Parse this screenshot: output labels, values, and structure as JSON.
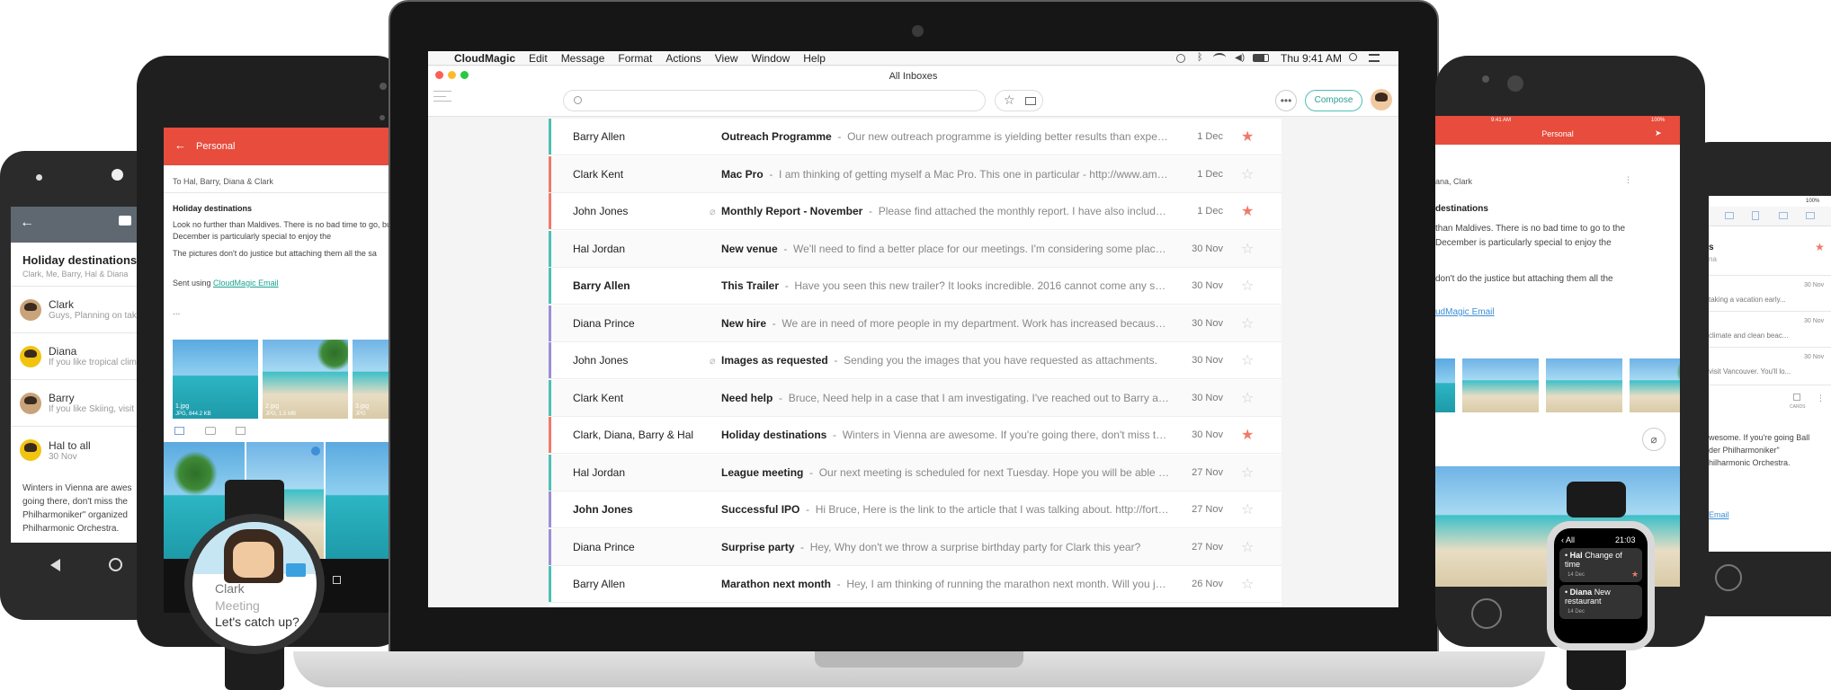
{
  "android_phone": {
    "title": "Holiday destinations",
    "participants": "Clark, Me, Barry, Hal & Diana",
    "items": [
      {
        "name": "Clark",
        "preview": "Guys, Planning on taking"
      },
      {
        "name": "Diana",
        "preview": "If you like tropical climate"
      },
      {
        "name": "Barry",
        "preview": "If you like Skiing, visit Van"
      },
      {
        "name": "Hal to all",
        "preview": "30 Nov"
      }
    ],
    "body": "Winters in Vienna are awes going there, don't miss the Philharmoniker\" organized Philharmonic Orchestra."
  },
  "android_tablet": {
    "folder": "Personal",
    "to": "To Hal, Barry, Diana & Clark",
    "subject": "Holiday destinations",
    "body1": "Look no further than Maldives. There is no bad time to go, but December is particularly special to enjoy the",
    "body2": "The pictures don't do justice but attaching them all the sa",
    "sent_using": "Sent using",
    "sent_link": "CloudMagic Email",
    "ellipsis": "...",
    "attachments": [
      {
        "name": "1.jpg",
        "meta": "JPG, 844.2 KB"
      },
      {
        "name": "2.jpg",
        "meta": "JPG, 1.5 MB"
      },
      {
        "name": "3.jpg",
        "meta": "JPG"
      }
    ]
  },
  "watch_round": {
    "sender": "Clark",
    "subject": "Meeting",
    "preview": "Let's catch up?"
  },
  "mac": {
    "menu": [
      "CloudMagic",
      "Edit",
      "Message",
      "Format",
      "Actions",
      "View",
      "Window",
      "Help"
    ],
    "clock": "Thu 9:41 AM",
    "window_title": "All Inboxes",
    "compose_label": "Compose",
    "emails": [
      {
        "sender": "Barry Allen",
        "subject": "Outreach Programme",
        "preview": "Our new outreach programme is yielding better results than expected. I have s...",
        "date": "1 Dec",
        "starred": true,
        "unread": false,
        "attach": false,
        "color": "#4dc0b5"
      },
      {
        "sender": "Clark Kent",
        "subject": "Mac Pro",
        "preview": "I am thinking of getting myself a Mac Pro. This one in particular - http://www.amazon.com/Ap...",
        "date": "1 Dec",
        "starred": false,
        "unread": false,
        "attach": false,
        "color": "#f07a6a"
      },
      {
        "sender": "John Jones",
        "subject": "Monthly Report - November",
        "preview": "Please find attached the monthly report. I have also included the stats re...",
        "date": "1 Dec",
        "starred": true,
        "unread": false,
        "attach": true,
        "color": "#f07a6a"
      },
      {
        "sender": "Hal Jordan",
        "subject": "New venue",
        "preview": "We'll need to find a better place for our meetings. I'm considering some places. Let me kn...",
        "date": "30 Nov",
        "starred": false,
        "unread": false,
        "attach": false,
        "color": "#4dc0b5"
      },
      {
        "sender": "Barry Allen",
        "subject": "This Trailer",
        "preview": "Have you seen this new trailer? It looks incredible. 2016 cannot come any soon. https://w...",
        "date": "30 Nov",
        "starred": false,
        "unread": true,
        "attach": false,
        "color": "#4dc0b5"
      },
      {
        "sender": "Diana Prince",
        "subject": "New hire",
        "preview": "We are in need of more people in my department. Work has increased because of the new v...",
        "date": "30 Nov",
        "starred": false,
        "unread": false,
        "attach": false,
        "color": "#9b8fd6"
      },
      {
        "sender": "John Jones",
        "subject": "Images as requested",
        "preview": "Sending you the images that you have requested as attachments.",
        "date": "30 Nov",
        "starred": false,
        "unread": false,
        "attach": true,
        "color": "#9b8fd6"
      },
      {
        "sender": "Clark Kent",
        "subject": "Need help",
        "preview": "Bruce, Need help in a case that I am investigating. I've reached out to Barry as well. Let me...",
        "date": "30 Nov",
        "starred": false,
        "unread": false,
        "attach": false,
        "color": "#4dc0b5"
      },
      {
        "sender": "Clark, Diana, Barry & Hal",
        "subject": "Holiday destinations",
        "preview": "Winters in Vienna are awesome. If you're going there, don't miss the \"Ball der Phi...",
        "date": "30 Nov",
        "starred": true,
        "unread": false,
        "attach": false,
        "color": "#f07a6a"
      },
      {
        "sender": "Hal Jordan",
        "subject": "League meeting",
        "preview": "Our next meeting is scheduled for next Tuesday. Hope you will be able to make it.",
        "date": "27 Nov",
        "starred": false,
        "unread": false,
        "attach": false,
        "color": "#4dc0b5"
      },
      {
        "sender": "John Jones",
        "subject": "Successful IPO",
        "preview": "Hi Bruce, Here is the link to the article that I was talking about. http://fortune.com/20...",
        "date": "27 Nov",
        "starred": false,
        "unread": true,
        "attach": false,
        "color": "#9b8fd6"
      },
      {
        "sender": "Diana Prince",
        "subject": "Surprise party",
        "preview": "Hey, Why don't we throw a surprise birthday party for Clark this year?",
        "date": "27 Nov",
        "starred": false,
        "unread": false,
        "attach": false,
        "color": "#9b8fd6"
      },
      {
        "sender": "Barry Allen",
        "subject": "Marathon next month",
        "preview": "Hey, I am thinking of running the marathon next month. Will you join me?",
        "date": "26 Nov",
        "starred": false,
        "unread": false,
        "attach": false,
        "color": "#4dc0b5"
      }
    ]
  },
  "ipad": {
    "status_time": "9:41 AM",
    "status_battery": "100%",
    "folder": "Personal",
    "to_fragment": "ana, Clark",
    "subject_fragment": "destinations",
    "body1": "than Maldives. There is no bad time to go to the December is particularly special to enjoy the",
    "body2": "don't do the justice but attaching them all the",
    "link_fragment": "udMagic Email"
  },
  "apple_watch": {
    "back": "All",
    "time": "21:03",
    "items": [
      {
        "sender": "Hal",
        "subject": "Change of time",
        "date": "14 Dec",
        "starred": true
      },
      {
        "sender": "Diana",
        "subject": "New restaurant",
        "date": "14 Dec",
        "starred": false
      }
    ]
  },
  "iphone": {
    "battery": "100%",
    "items": [
      {
        "title": "s",
        "sub": "na",
        "date": "",
        "preview": ""
      },
      {
        "date": "30 Nov",
        "preview": "taking a vacation early..."
      },
      {
        "date": "30 Nov",
        "preview": "climate and clean beac..."
      },
      {
        "date": "30 Nov",
        "preview": "visit Vancouver. You'll lo..."
      }
    ],
    "cards_label": "CARDS",
    "body": "wesome. If you're going Ball der Philharmoniker\" hilharmonic Orchestra.",
    "link": "Email"
  }
}
